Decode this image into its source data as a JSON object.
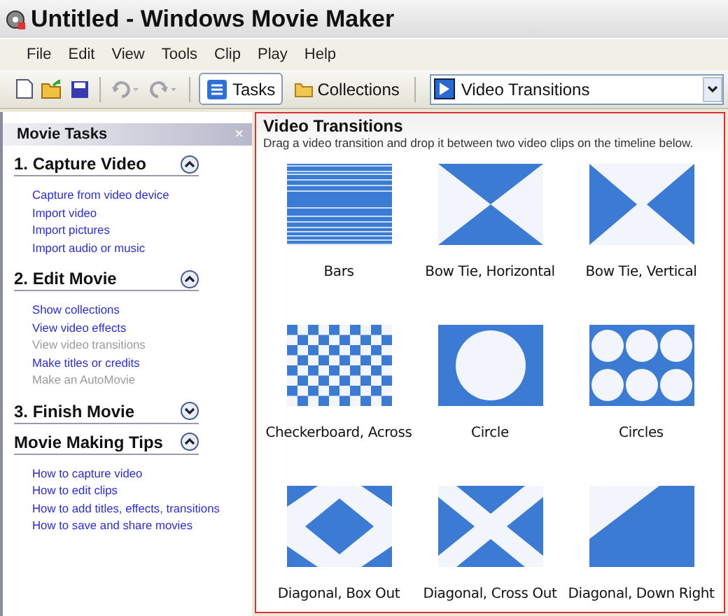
{
  "window": {
    "title": "Untitled - Windows Movie Maker"
  },
  "menu": [
    "File",
    "Edit",
    "View",
    "Tools",
    "Clip",
    "Play",
    "Help"
  ],
  "toolbar": {
    "tasks": {
      "label": "Tasks",
      "selected": true
    },
    "collections": {
      "label": "Collections",
      "selected": false
    },
    "undo_disabled": true,
    "redo_disabled": true,
    "location": "Video Transitions"
  },
  "sidebar": {
    "title": "Movie Tasks",
    "close": "×",
    "sections": [
      {
        "title": "1. Capture Video",
        "expanded": true,
        "links": [
          {
            "label": "Capture from video device",
            "disabled": false
          },
          {
            "label": "Import video",
            "disabled": false
          },
          {
            "label": "Import pictures",
            "disabled": false
          },
          {
            "label": "Import audio or music",
            "disabled": false
          }
        ]
      },
      {
        "title": "2. Edit Movie",
        "expanded": true,
        "links": [
          {
            "label": "Show collections",
            "disabled": false
          },
          {
            "label": "View video effects",
            "disabled": false
          },
          {
            "label": "View video transitions",
            "disabled": true
          },
          {
            "label": "Make titles or credits",
            "disabled": false
          },
          {
            "label": "Make an AutoMovie",
            "disabled": true
          }
        ]
      },
      {
        "title": "3. Finish Movie",
        "expanded": false
      },
      {
        "title": "Movie Making Tips",
        "expanded": true,
        "links": [
          {
            "label": "How to capture video",
            "disabled": false
          },
          {
            "label": "How to edit clips",
            "disabled": false
          },
          {
            "label": "How to add titles, effects, transitions",
            "disabled": false
          },
          {
            "label": "How to save and share movies",
            "disabled": false
          }
        ]
      }
    ]
  },
  "content": {
    "title": "Video Transitions",
    "subtitle": "Drag a video transition and drop it between two video clips on the timeline below.",
    "transitions": [
      {
        "label": "Bars",
        "kind": "bars"
      },
      {
        "label": "Bow Tie, Horizontal",
        "kind": "bowtie_h"
      },
      {
        "label": "Bow Tie, Vertical",
        "kind": "bowtie_v"
      },
      {
        "label": "Checkerboard, Across",
        "kind": "checker"
      },
      {
        "label": "Circle",
        "kind": "circle"
      },
      {
        "label": "Circles",
        "kind": "circles"
      },
      {
        "label": "Diagonal, Box Out",
        "kind": "diag_box"
      },
      {
        "label": "Diagonal, Cross Out",
        "kind": "diag_cross"
      },
      {
        "label": "Diagonal, Down Right",
        "kind": "diag_down"
      }
    ]
  }
}
